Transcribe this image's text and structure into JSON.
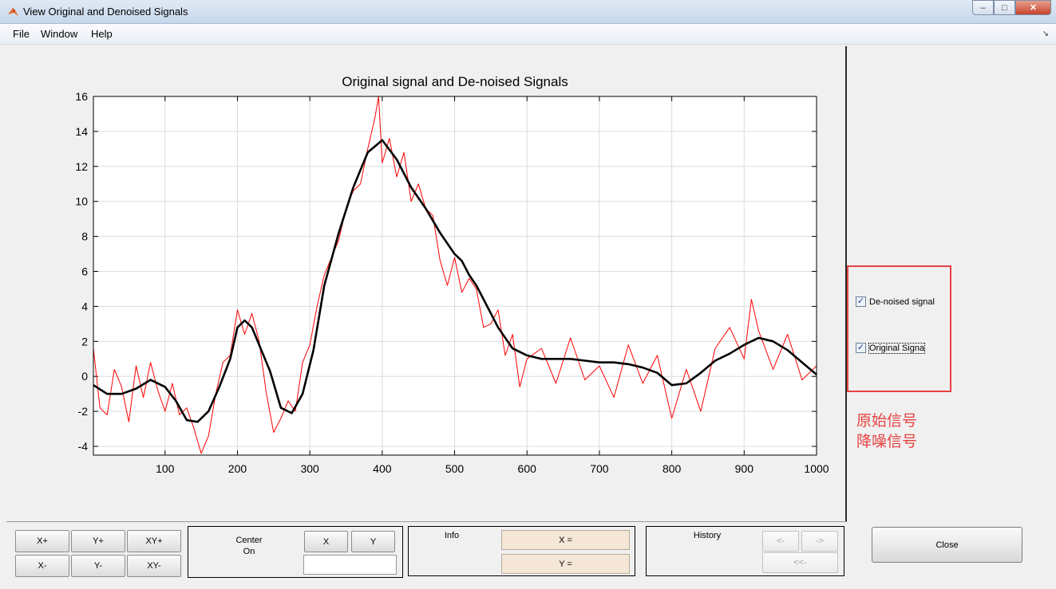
{
  "window": {
    "title": "View Original and Denoised Signals",
    "minimize": "–",
    "maximize": "□",
    "close": "✕"
  },
  "menu": {
    "file": "File",
    "window": "Window",
    "help": "Help",
    "dock": "↘"
  },
  "chart_data": {
    "type": "line",
    "title": "Original signal and De-noised Signals",
    "xlim": [
      1,
      1000
    ],
    "ylim": [
      -4.5,
      16
    ],
    "xticks": [
      100,
      200,
      300,
      400,
      500,
      600,
      700,
      800,
      900,
      1000
    ],
    "yticks": [
      -4,
      -2,
      0,
      2,
      4,
      6,
      8,
      10,
      12,
      14,
      16
    ],
    "grid": true,
    "series": [
      {
        "color": "#ff0000",
        "x": [
          1,
          10,
          20,
          30,
          40,
          50,
          60,
          70,
          80,
          90,
          100,
          110,
          120,
          130,
          140,
          150,
          160,
          170,
          180,
          190,
          200,
          210,
          220,
          230,
          240,
          250,
          260,
          270,
          280,
          290,
          300,
          310,
          320,
          330,
          340,
          350,
          360,
          370,
          380,
          390,
          395,
          400,
          410,
          420,
          430,
          440,
          450,
          460,
          470,
          480,
          490,
          500,
          510,
          520,
          530,
          540,
          550,
          560,
          570,
          580,
          590,
          600,
          620,
          640,
          660,
          680,
          700,
          720,
          740,
          760,
          780,
          800,
          820,
          840,
          860,
          880,
          900,
          910,
          920,
          940,
          960,
          980,
          1000
        ],
        "y": [
          1.6,
          -1.8,
          -2.2,
          0.4,
          -0.6,
          -2.6,
          0.6,
          -1.2,
          0.8,
          -0.8,
          -2.0,
          -0.4,
          -2.2,
          -1.8,
          -3.0,
          -4.4,
          -3.4,
          -1.0,
          0.8,
          1.2,
          3.8,
          2.4,
          3.6,
          2.0,
          -1.0,
          -3.2,
          -2.4,
          -1.4,
          -2.0,
          0.8,
          1.8,
          4.0,
          5.8,
          6.8,
          7.8,
          9.6,
          10.6,
          11.0,
          13.0,
          14.8,
          16.0,
          12.2,
          13.6,
          11.4,
          12.8,
          10.0,
          11.0,
          9.6,
          9.2,
          6.6,
          5.2,
          6.8,
          4.8,
          5.6,
          5.0,
          2.8,
          3.0,
          3.8,
          1.2,
          2.4,
          -0.6,
          1.0,
          1.6,
          -0.4,
          2.2,
          -0.2,
          0.6,
          -1.2,
          1.8,
          -0.4,
          1.2,
          -2.4,
          0.4,
          -2.0,
          1.6,
          2.8,
          1.0,
          4.4,
          2.6,
          0.4,
          2.4,
          -0.2,
          0.6
        ]
      },
      {
        "color": "#000000",
        "x": [
          1,
          20,
          40,
          60,
          80,
          100,
          115,
          130,
          145,
          160,
          175,
          190,
          200,
          210,
          220,
          230,
          245,
          260,
          275,
          290,
          305,
          320,
          340,
          360,
          380,
          400,
          420,
          440,
          460,
          480,
          500,
          510,
          520,
          530,
          545,
          560,
          580,
          600,
          620,
          640,
          660,
          680,
          700,
          720,
          740,
          760,
          780,
          800,
          820,
          840,
          860,
          880,
          900,
          920,
          940,
          960,
          980,
          1000
        ],
        "y": [
          -0.5,
          -1.0,
          -1.0,
          -0.7,
          -0.2,
          -0.6,
          -1.4,
          -2.5,
          -2.6,
          -2.0,
          -0.6,
          1.0,
          2.8,
          3.2,
          2.8,
          1.8,
          0.3,
          -1.8,
          -2.1,
          -1.0,
          1.5,
          5.2,
          8.2,
          10.8,
          12.8,
          13.5,
          12.4,
          10.8,
          9.6,
          8.2,
          7.0,
          6.6,
          5.8,
          5.2,
          4.0,
          2.8,
          1.6,
          1.2,
          1.0,
          1.0,
          1.0,
          0.9,
          0.8,
          0.8,
          0.7,
          0.5,
          0.2,
          -0.5,
          -0.4,
          0.2,
          0.9,
          1.3,
          1.8,
          2.2,
          2.0,
          1.5,
          0.8,
          0.1
        ]
      }
    ]
  },
  "legend": {
    "denoised": "De-noised signal",
    "original": "Original Signa",
    "check": "✓"
  },
  "annotation": {
    "line1": "原始信号",
    "line2": "降噪信号"
  },
  "zoom": {
    "xplus": "X+",
    "yplus": "Y+",
    "xyplus": "XY+",
    "xminus": "X-",
    "yminus": "Y-",
    "xyminus": "XY-"
  },
  "center": {
    "label1": "Center",
    "label2": "On",
    "x": "X",
    "y": "Y",
    "value": ""
  },
  "info": {
    "label": "Info",
    "x": "X =",
    "y": "Y ="
  },
  "history": {
    "label": "History",
    "back": "<-",
    "forward": "->",
    "first": "<<-"
  },
  "close_label": "Close"
}
